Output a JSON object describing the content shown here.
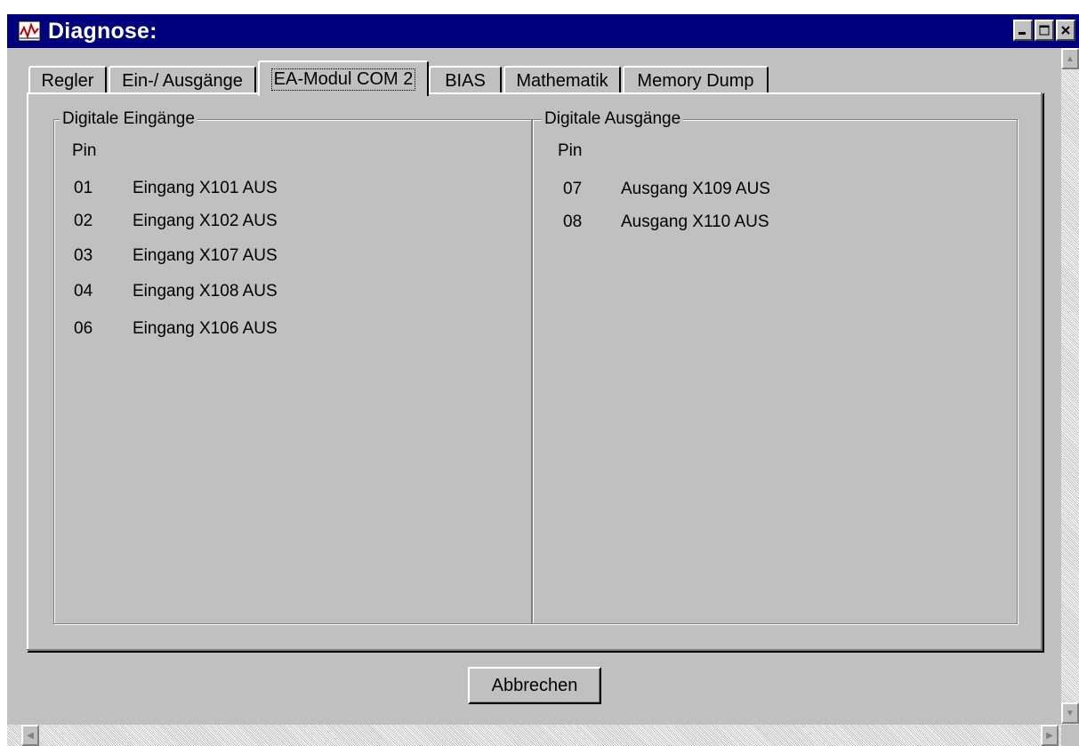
{
  "window": {
    "title": "Diagnose:",
    "icon": "diagnose-app-icon",
    "controls": {
      "minimize": "minimize-icon",
      "maximize": "maximize-icon",
      "close": "close-icon"
    }
  },
  "tabs": [
    {
      "label": "Regler",
      "active": false
    },
    {
      "label": "Ein-/ Ausgänge",
      "active": false
    },
    {
      "label": "EA-Modul COM 2",
      "active": true
    },
    {
      "label": "BIAS",
      "active": false
    },
    {
      "label": "Mathematik",
      "active": false
    },
    {
      "label": "Memory Dump",
      "active": false
    }
  ],
  "inputs": {
    "group_title": "Digitale Eingänge",
    "column_header": "Pin",
    "rows": [
      {
        "pin": "01",
        "label": "Eingang X101 AUS"
      },
      {
        "pin": "02",
        "label": "Eingang X102 AUS"
      },
      {
        "pin": "03",
        "label": "Eingang X107 AUS"
      },
      {
        "pin": "04",
        "label": "Eingang X108 AUS"
      },
      {
        "pin": "06",
        "label": "Eingang X106 AUS"
      }
    ]
  },
  "outputs": {
    "group_title": "Digitale Ausgänge",
    "column_header": "Pin",
    "rows": [
      {
        "pin": "07",
        "label": "Ausgang X109 AUS"
      },
      {
        "pin": "08",
        "label": "Ausgang X110 AUS"
      }
    ]
  },
  "buttons": {
    "cancel_label": "Abbrechen"
  },
  "colors": {
    "titlebar": "#00007f",
    "face": "#c0c0c0"
  }
}
